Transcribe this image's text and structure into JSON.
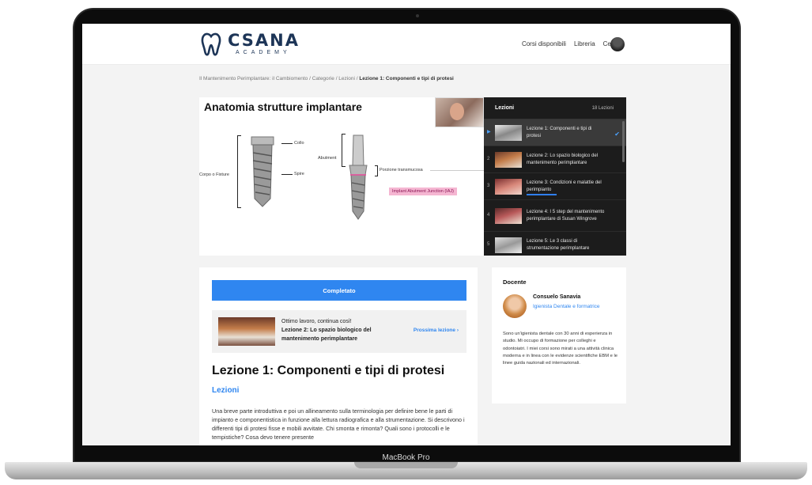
{
  "device": {
    "chin_label": "MacBook Pro"
  },
  "header": {
    "logo_text": "CSANA",
    "logo_sub": "ACADEMY",
    "nav": [
      "Corsi disponibili",
      "Libreria",
      "Cerca"
    ]
  },
  "breadcrumb": {
    "trail": "Il Mantenimento Perimplantare: il Cambiomento / Categorie / Lezioni / ",
    "current": "Lezione 1: Componenti e tipi di protesi"
  },
  "slide": {
    "title": "Anatomia strutture implantare",
    "labels": {
      "collo": "Collo",
      "spire": "Spire",
      "corpo": "Corpo o Fixture",
      "abutment": "Abutment",
      "porzione": "Porzione transmucosa",
      "junction": "Implant Abutment Junction (IAJ)"
    }
  },
  "lessons_panel": {
    "title": "Lezioni",
    "count": "18 Lezioni",
    "items": [
      {
        "num": "",
        "title": "Lezione 1: Componenti e tipi di protesi",
        "active": true
      },
      {
        "num": "2",
        "title": "Lezione 2: Lo spazio biologico del mantenimento perimplantare"
      },
      {
        "num": "3",
        "title": "Lezione 3: Condizioni e malattie del perimpianto"
      },
      {
        "num": "4",
        "title": "Lezione 4: I 5 step del mantenimento perimplantare di Susan Wingrove"
      },
      {
        "num": "5",
        "title": "Lezione 5: Le 3 classi di strumentazione perimplantare"
      }
    ]
  },
  "content": {
    "complete_label": "Completato",
    "next_intro": "Ottimo lavoro, continua così!",
    "next_title": "Lezione 2: Lo spazio biologico del mantenimento perimplantare",
    "next_link": "Prossima lezione",
    "lesson_title": "Lezione 1: Componenti e tipi di protesi",
    "section_link": "Lezioni",
    "description": "Una breve parte introduttiva e poi un allineamento sulla terminologia per definire bene le parti di impianto e componentistica in funzione alla lettura radiografica e alla strumentazione. Si descrivono i differenti tipi di protesi fisse e mobili avvitate. Chi smonta e rimonta? Quali sono i protocolli e le tempistiche? Cosa devo tenere presente"
  },
  "teacher": {
    "heading": "Docente",
    "name": "Consuelo Sanavia",
    "role": "Igienista Dentale e formatrice",
    "bio": "Sono un'igienista dentale con 30 anni di esperienza in studio. Mi occupo di formazione per colleghi e odontoiatri. I miei corsi sono mirati a una attività clinica moderna e in linea con le evidenze scientifiche EBM e le linee guida nazionali ed internazionali."
  },
  "colors": {
    "accent": "#2f86f0",
    "panel": "#1c1c1c",
    "logo": "#1d3557"
  }
}
